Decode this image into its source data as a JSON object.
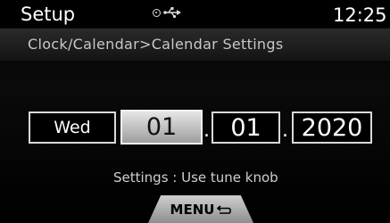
{
  "header": {
    "title": "Setup",
    "clock": "12:25",
    "icons": [
      "disc-icon",
      "usb-icon"
    ]
  },
  "breadcrumb": "Clock/Calendar>Calendar Settings",
  "date": {
    "weekday": "Wed",
    "day": "01",
    "month": "01",
    "year": "2020",
    "separator": "."
  },
  "hint": "Settings : Use tune knob",
  "menu": {
    "label": "MENU",
    "icon": "return-icon"
  },
  "colors": {
    "background": "#000000",
    "selected_field": "#c8c8c8",
    "text": "#ffffff"
  }
}
